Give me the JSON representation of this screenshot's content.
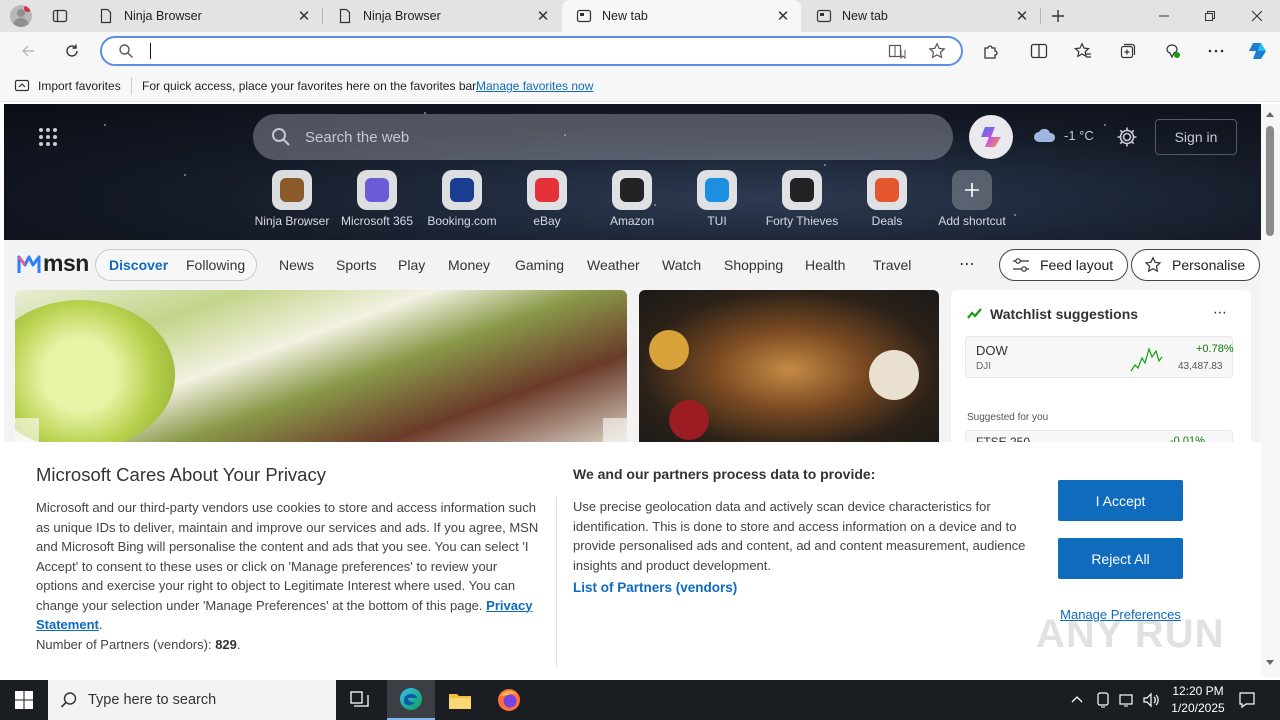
{
  "tabs": [
    {
      "label": "Ninja Browser",
      "active": false
    },
    {
      "label": "Ninja Browser",
      "active": false
    },
    {
      "label": "New tab",
      "active": true
    },
    {
      "label": "New tab",
      "active": false
    }
  ],
  "favorites_bar": {
    "import_label": "Import favorites",
    "hint": "For quick access, place your favorites here on the favorites bar.",
    "manage_link": "Manage favorites now"
  },
  "address_bar": {
    "value": "",
    "placeholder": ""
  },
  "msn": {
    "search_placeholder": "Search the web",
    "weather": "-1 °C",
    "sign_in": "Sign in",
    "shortcuts": [
      {
        "label": "Ninja Browser",
        "icon": "ninja-browser-icon",
        "color": "#8a5a2b"
      },
      {
        "label": "Microsoft 365",
        "icon": "microsoft-365-icon",
        "color": "#6b5bd6"
      },
      {
        "label": "Booking.com",
        "icon": "booking-icon",
        "color": "#1a3d8f"
      },
      {
        "label": "eBay",
        "icon": "ebay-icon",
        "color": "#e53238"
      },
      {
        "label": "Amazon",
        "icon": "amazon-icon",
        "color": "#222"
      },
      {
        "label": "TUI",
        "icon": "tui-icon",
        "color": "#1d8fe0"
      },
      {
        "label": "Forty Thieves",
        "icon": "forty-thieves-icon",
        "color": "#222"
      },
      {
        "label": "Deals",
        "icon": "deals-icon",
        "color": "#e4572e"
      },
      {
        "label": "Add shortcut",
        "icon": "plus-icon",
        "color": "#ffffff"
      }
    ],
    "logo": "msn",
    "nav": {
      "discover": "Discover",
      "following": "Following",
      "items": [
        "News",
        "Sports",
        "Play",
        "Money",
        "Gaming",
        "Weather",
        "Watch",
        "Shopping",
        "Health",
        "Travel"
      ],
      "feed_layout": "Feed layout",
      "personalise": "Personalise"
    },
    "watchlist": {
      "title": "Watchlist suggestions",
      "item": {
        "symbol": "DOW",
        "exchange": "DJI",
        "change": "+0.78%",
        "value": "43,487.83"
      },
      "suggested": "Suggested for you",
      "partial": {
        "symbol": "FTSE 250",
        "change": "-0.01%"
      }
    }
  },
  "privacy": {
    "title": "Microsoft Cares About Your Privacy",
    "body": "Microsoft and our third-party vendors use cookies to store and access information such as unique IDs to deliver, maintain and improve our services and ads. If you agree, MSN and Microsoft Bing will personalise the content and ads that you see. You can select 'I Accept' to consent to these uses or click on 'Manage preferences' to review your options and exercise your right to object to Legitimate Interest where used.  You can change your selection under 'Manage Preferences' at the bottom of this page.",
    "statement_link": "Privacy Statement",
    "partners_label": "Number of Partners (vendors):",
    "partners_count": "829",
    "right_title": "We and our partners process data to provide:",
    "right_body": "Use precise geolocation data and actively scan device characteristics for identification. This is done to store and access information on a device and to provide personalised ads and content, ad and content measurement, audience insights and product development.",
    "list_link": "List of Partners (vendors)",
    "accept": "I Accept",
    "reject": "Reject All",
    "manage": "Manage Preferences"
  },
  "taskbar": {
    "search_placeholder": "Type here to search",
    "time": "12:20 PM",
    "date": "1/20/2025"
  },
  "watermark": "ANY RUN",
  "colors": {
    "accent": "#0f6cbd",
    "edge_blue": "#5b8ee6",
    "positive": "#0e7a0d"
  }
}
